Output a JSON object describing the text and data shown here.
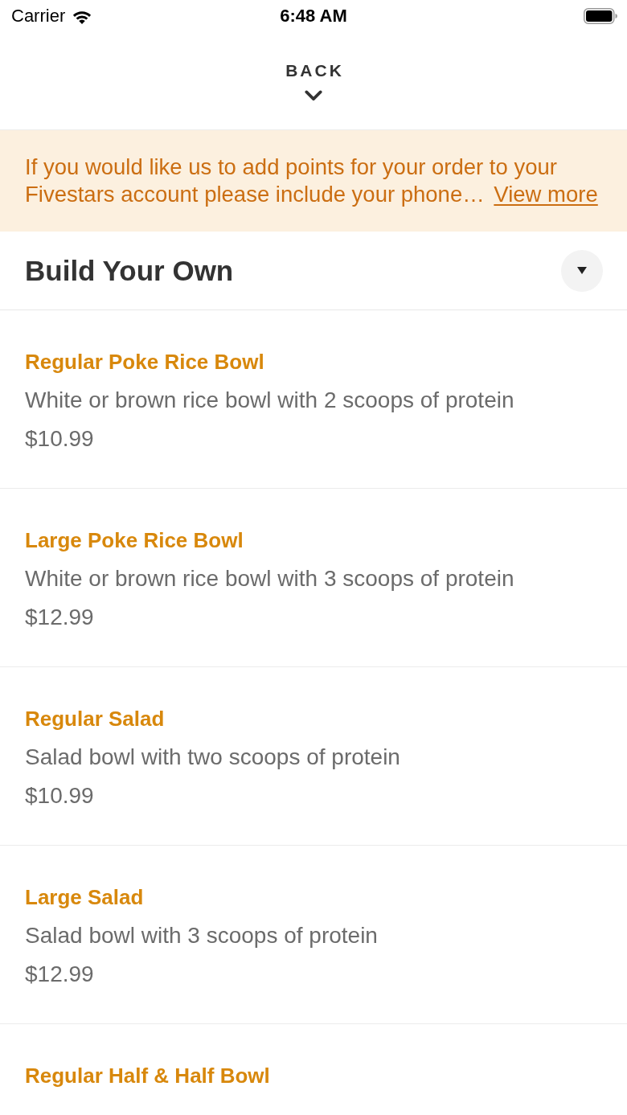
{
  "status_bar": {
    "carrier": "Carrier",
    "time": "6:48 AM"
  },
  "header": {
    "back_label": "BACK"
  },
  "banner": {
    "message": "If you would like us to add points for your order to your Fivestars account please include your phone…",
    "link": "View more"
  },
  "section": {
    "title": "Build Your Own"
  },
  "items": [
    {
      "title": "Regular Poke Rice Bowl",
      "description": "White or brown rice bowl with 2 scoops of protein",
      "price": "$10.99"
    },
    {
      "title": "Large Poke Rice Bowl",
      "description": "White or brown rice bowl with 3 scoops of protein",
      "price": "$12.99"
    },
    {
      "title": "Regular Salad",
      "description": "Salad bowl with two scoops of protein",
      "price": "$10.99"
    },
    {
      "title": "Large Salad",
      "description": "Salad bowl with 3 scoops of protein",
      "price": "$12.99"
    },
    {
      "title": "Regular Half & Half Bowl"
    }
  ]
}
